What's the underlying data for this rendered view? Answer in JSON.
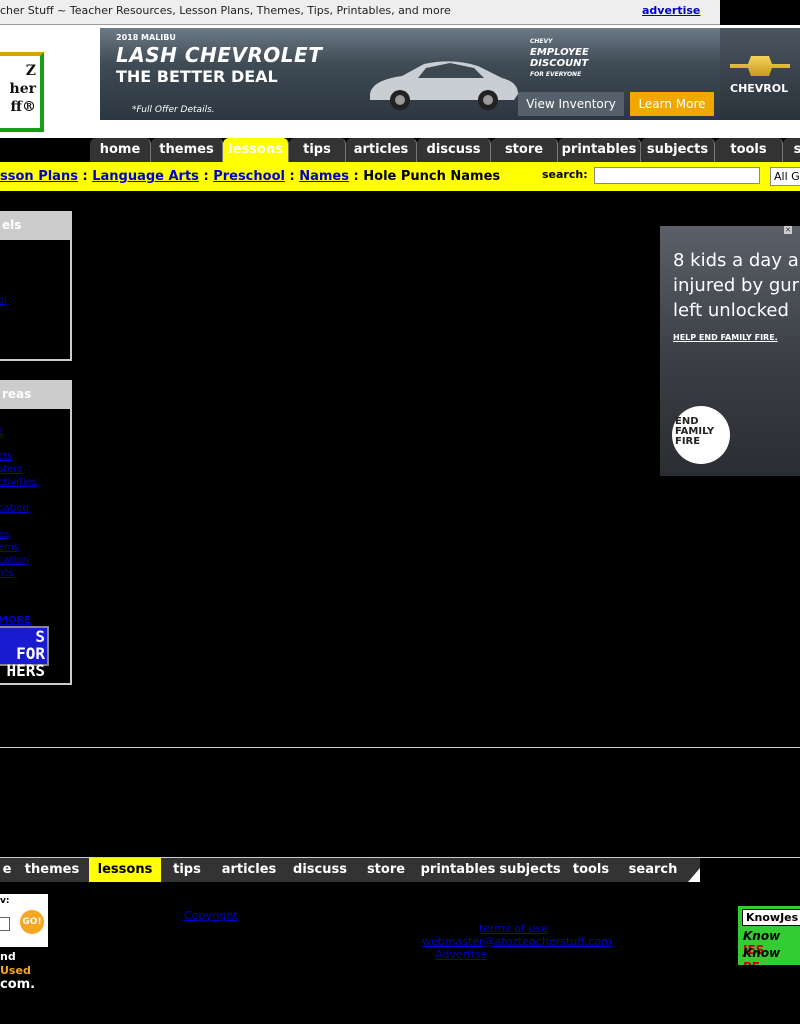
{
  "topbar": {
    "site_title": "cher Stuff ~ Teacher Resources, Lesson Plans, Themes, Tips, Printables, and more",
    "advertise": "advertise"
  },
  "logo": {
    "text": "Z\nher\nff®"
  },
  "banner_ad": {
    "model": "2018 MALIBU",
    "dealer": "LASH CHEVROLET",
    "tagline": "THE BETTER DEAL",
    "fine_print": "*Full Offer Details.",
    "promo_top": "CHEVY",
    "promo_main": "EMPLOYEE DISCOUNT",
    "promo_sub": "FOR EVERYONE",
    "view_inventory": "View Inventory",
    "learn_more": "Learn More",
    "brand": "CHEVROL"
  },
  "nav": {
    "tabs": [
      "home",
      "themes",
      "lessons",
      "tips",
      "articles",
      "discuss",
      "store",
      "printables",
      "subjects",
      "tools",
      "s"
    ],
    "active": "lessons"
  },
  "breadcrumb": {
    "items": [
      "sson Plans",
      "Language Arts",
      "Preschool",
      "Names"
    ],
    "current": "Hole Punch Names",
    "separator": ":"
  },
  "search": {
    "label": "search:",
    "select_value": "All G"
  },
  "sidebar": {
    "levels_title": "els",
    "levels_link": "ol",
    "areas_title": "reas",
    "areas_links": [
      "s",
      "cts",
      "sters",
      "ctivities",
      "cation",
      "es",
      "ems",
      "cation",
      "nts"
    ],
    "more": "MORE",
    "teachers_btn": "S FOR\nHERS"
  },
  "right_ad": {
    "headline_1": "8 kids a day a",
    "headline_2": "injured by gur",
    "headline_3": "left unlocked",
    "help": "HELP END FAMILY FIRE.",
    "badge": "END\nFAMILY\nFIRE"
  },
  "bottom_nav": {
    "tabs": [
      "e",
      "themes",
      "lessons",
      "tips",
      "articles",
      "discuss",
      "store",
      "printables",
      "subjects",
      "tools",
      "search"
    ],
    "active": "lessons"
  },
  "footer": {
    "search_label": "v:",
    "go": "GO!",
    "text_and": "nd",
    "text_used": "Used",
    "text_com": "com.",
    "copyright": "Copyright",
    "terms": "terms of use",
    "email": "webmaster@atozteacherstuff.com",
    "advertise": "Advertise"
  },
  "knowjesus_ad": {
    "top": "KnowJes",
    "line1_know": "Know",
    "line1_word": "JES",
    "line2_know": "Know",
    "line2_word": "PE"
  },
  "colors": {
    "background": "#000000",
    "nav_active": "#ffff00",
    "link": "#0000cc",
    "tab": "#333333"
  }
}
